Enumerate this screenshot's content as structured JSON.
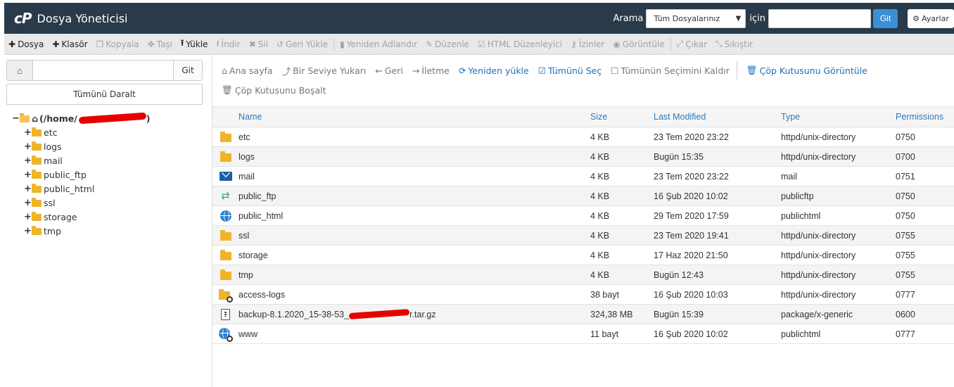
{
  "header": {
    "logo_text": "cP",
    "title": "Dosya Yöneticisi",
    "search_label": "Arama",
    "search_scope": "Tüm Dosyalarınız",
    "search_for_label": "için",
    "search_go_label": "Git",
    "settings_label": "Ayarlar"
  },
  "toolbar": {
    "items": [
      {
        "label": "Dosya",
        "icon": "plus-icon",
        "state": "active"
      },
      {
        "label": "Klasör",
        "icon": "plus-icon",
        "state": "active"
      },
      {
        "label": "Kopyala",
        "icon": "copy-icon",
        "state": "disabled"
      },
      {
        "label": "Taşı",
        "icon": "move-icon",
        "state": "disabled"
      },
      {
        "label": "Yükle",
        "icon": "upload-icon",
        "state": "active"
      },
      {
        "label": "İndir",
        "icon": "download-icon",
        "state": "disabled"
      },
      {
        "label": "Sil",
        "icon": "delete-icon",
        "state": "disabled"
      },
      {
        "label": "Geri Yükle",
        "icon": "restore-icon",
        "state": "disabled"
      },
      {
        "label": "Yeniden Adlandır",
        "icon": "file-icon",
        "state": "disabled"
      },
      {
        "label": "Düzenle",
        "icon": "pencil-icon",
        "state": "disabled"
      },
      {
        "label": "HTML Düzenleyici",
        "icon": "html-edit-icon",
        "state": "disabled"
      },
      {
        "label": "İzinler",
        "icon": "key-icon",
        "state": "disabled"
      },
      {
        "label": "Görüntüle",
        "icon": "eye-icon",
        "state": "disabled"
      },
      {
        "label": "Çıkar",
        "icon": "extract-icon",
        "state": "disabled"
      },
      {
        "label": "Sıkıştır",
        "icon": "compress-icon",
        "state": "disabled"
      }
    ]
  },
  "left_panel": {
    "path_go_label": "Git",
    "collapse_label": "Tümünü Daralt",
    "root_prefix": "(/home/",
    "root_suffix": ")",
    "folders": [
      "etc",
      "logs",
      "mail",
      "public_ftp",
      "public_html",
      "ssl",
      "storage",
      "tmp"
    ]
  },
  "actions": {
    "row1": [
      {
        "label": "Ana sayfa",
        "icon": "home-icon",
        "color": "gray"
      },
      {
        "label": "Bir Seviye Yukarı",
        "icon": "level-up-icon",
        "color": "gray"
      },
      {
        "label": "Geri",
        "icon": "arrow-left-icon",
        "color": "gray"
      },
      {
        "label": "İletme",
        "icon": "arrow-right-icon",
        "color": "gray"
      },
      {
        "label": "Yeniden yükle",
        "icon": "refresh-icon",
        "color": "blue"
      },
      {
        "label": "Tümünü Seç",
        "icon": "checkbox-checked-icon",
        "color": "blue"
      },
      {
        "label": "Tümünün Seçimini Kaldır",
        "icon": "checkbox-empty-icon",
        "color": "gray"
      },
      {
        "label": "Çöp Kutusunu Görüntüle",
        "icon": "trash-icon",
        "color": "blue"
      }
    ],
    "row2": [
      {
        "label": "Çöp Kutusunu Boşalt",
        "icon": "trash-icon",
        "color": "gray"
      }
    ]
  },
  "table": {
    "headers": {
      "name": "Name",
      "size": "Size",
      "modified": "Last Modified",
      "type": "Type",
      "perms": "Permissions"
    },
    "rows": [
      {
        "icon": "folder-icon",
        "name": "etc",
        "size": "4 KB",
        "modified": "23 Tem 2020 23:22",
        "type": "httpd/unix-directory",
        "perms": "0750"
      },
      {
        "icon": "folder-icon",
        "name": "logs",
        "size": "4 KB",
        "modified": "Bugün 15:35",
        "type": "httpd/unix-directory",
        "perms": "0700"
      },
      {
        "icon": "mail-icon",
        "name": "mail",
        "size": "4 KB",
        "modified": "23 Tem 2020 23:22",
        "type": "mail",
        "perms": "0751"
      },
      {
        "icon": "ftp-icon",
        "name": "public_ftp",
        "size": "4 KB",
        "modified": "16 Şub 2020 10:02",
        "type": "publicftp",
        "perms": "0750"
      },
      {
        "icon": "globe-icon",
        "name": "public_html",
        "size": "4 KB",
        "modified": "29 Tem 2020 17:59",
        "type": "publichtml",
        "perms": "0750"
      },
      {
        "icon": "folder-icon",
        "name": "ssl",
        "size": "4 KB",
        "modified": "23 Tem 2020 19:41",
        "type": "httpd/unix-directory",
        "perms": "0755"
      },
      {
        "icon": "folder-icon",
        "name": "storage",
        "size": "4 KB",
        "modified": "17 Haz 2020 21:50",
        "type": "httpd/unix-directory",
        "perms": "0755"
      },
      {
        "icon": "folder-icon",
        "name": "tmp",
        "size": "4 KB",
        "modified": "Bugün 12:43",
        "type": "httpd/unix-directory",
        "perms": "0755"
      },
      {
        "icon": "folder-link-icon",
        "name": "access-logs",
        "size": "38 bayt",
        "modified": "16 Şub 2020 10:03",
        "type": "httpd/unix-directory",
        "perms": "0777"
      },
      {
        "icon": "archive-icon",
        "name": "backup-8.1.2020_15-38-53_",
        "name_suffix": "r.tar.gz",
        "size": "324,38 MB",
        "modified": "Bugün 15:39",
        "type": "package/x-generic",
        "perms": "0600"
      },
      {
        "icon": "globe-link-icon",
        "name": "www",
        "size": "11 bayt",
        "modified": "16 Şub 2020 10:02",
        "type": "publichtml",
        "perms": "0777"
      }
    ]
  }
}
